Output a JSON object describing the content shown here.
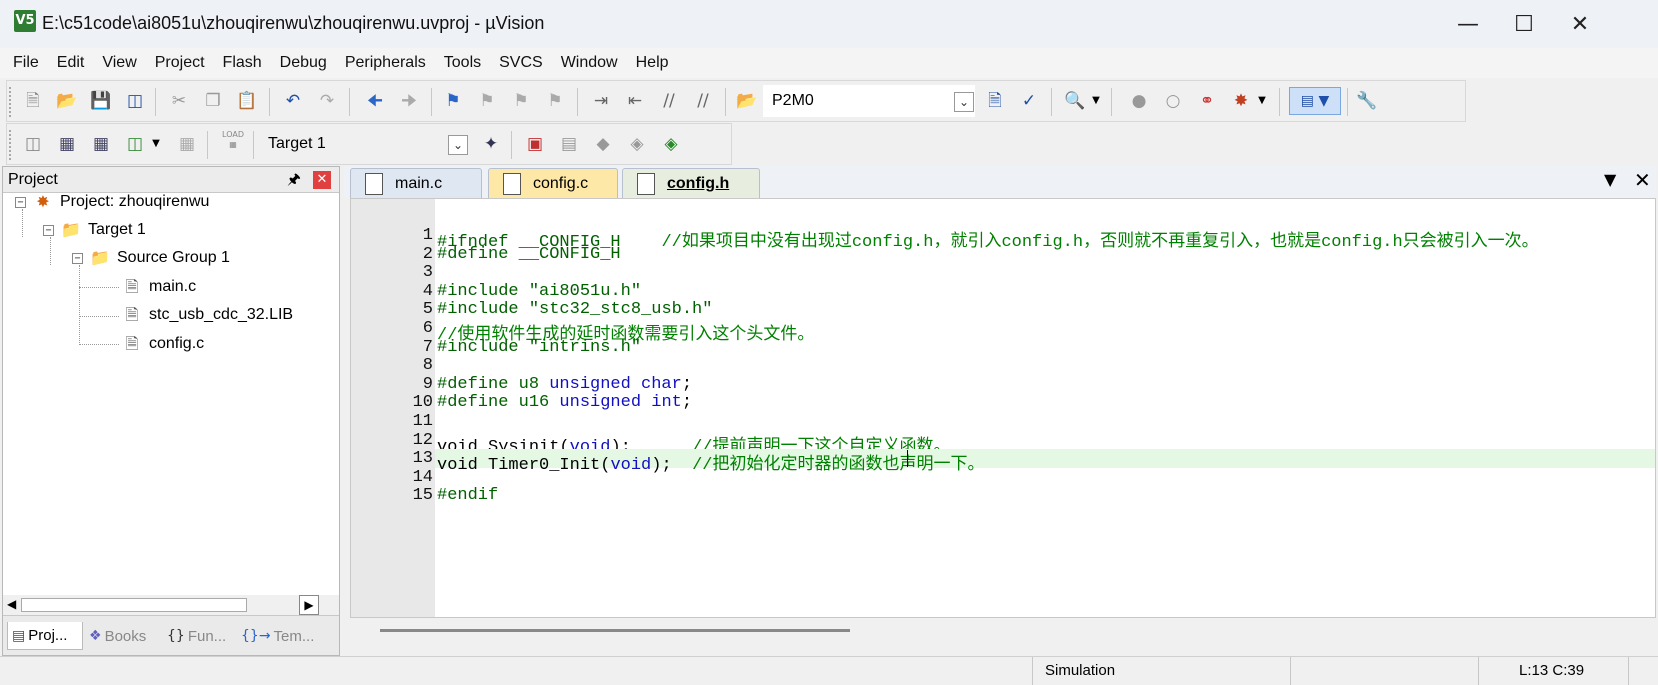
{
  "window": {
    "title": "E:\\c51code\\ai8051u\\zhouqirenwu\\zhouqirenwu.uvproj - µVision",
    "app_icon": "V5"
  },
  "menu": [
    "File",
    "Edit",
    "View",
    "Project",
    "Flash",
    "Debug",
    "Peripherals",
    "Tools",
    "SVCS",
    "Window",
    "Help"
  ],
  "toolbar": {
    "find_combo_value": "P2M0",
    "target_combo_value": "Target 1",
    "load_label": "LOAD"
  },
  "project_panel": {
    "title": "Project",
    "tree": {
      "project": "Project: zhouqirenwu",
      "target": "Target 1",
      "group": "Source Group 1",
      "files": [
        "main.c",
        "stc_usb_cdc_32.LIB",
        "config.c"
      ]
    },
    "tabs": [
      "Proj...",
      "Books",
      "Fun...",
      "Tem..."
    ]
  },
  "editor": {
    "tabs": [
      {
        "label": "main.c",
        "active": false
      },
      {
        "label": "config.c",
        "active": false
      },
      {
        "label": "config.h",
        "active": true
      }
    ],
    "current_line": 13,
    "lines": [
      [
        {
          "t": "pp",
          "v": "#ifndef __CONFIG_H    "
        },
        {
          "t": "cm",
          "v": "//如果项目中没有出现过config.h，就引入config.h，否则就不再重复引入，也就是config.h只会被引入一次。"
        }
      ],
      [
        {
          "t": "pp",
          "v": "#define __CONFIG_H"
        }
      ],
      [],
      [
        {
          "t": "pp",
          "v": "#include "
        },
        {
          "t": "str",
          "v": "\"ai8051u.h\""
        }
      ],
      [
        {
          "t": "pp",
          "v": "#include "
        },
        {
          "t": "str",
          "v": "\"stc32_stc8_usb.h\""
        }
      ],
      [
        {
          "t": "cm",
          "v": "//使用软件生成的延时函数需要引入这个头文件。"
        }
      ],
      [
        {
          "t": "pp",
          "v": "#include "
        },
        {
          "t": "str",
          "v": "\"intrins.h\""
        }
      ],
      [],
      [
        {
          "t": "pp",
          "v": "#define u8 "
        },
        {
          "t": "kw",
          "v": "unsigned char"
        },
        {
          "t": "n",
          "v": ";"
        }
      ],
      [
        {
          "t": "pp",
          "v": "#define u16 "
        },
        {
          "t": "kw",
          "v": "unsigned int"
        },
        {
          "t": "n",
          "v": ";"
        }
      ],
      [],
      [
        {
          "t": "n",
          "v": "void Sysinit("
        },
        {
          "t": "kw",
          "v": "void"
        },
        {
          "t": "n",
          "v": ");      "
        },
        {
          "t": "cm",
          "v": "//提前声明一下这个自定义函数。"
        }
      ],
      [
        {
          "t": "n",
          "v": "void Timer0_Init("
        },
        {
          "t": "kw",
          "v": "void"
        },
        {
          "t": "n",
          "v": ");  "
        },
        {
          "t": "cm",
          "v": "//把初始化定时器的函数也声明一下。"
        }
      ],
      [],
      [
        {
          "t": "pp",
          "v": "#endif"
        }
      ]
    ]
  },
  "status": {
    "mode": "Simulation",
    "position": "L:13 C:39"
  }
}
